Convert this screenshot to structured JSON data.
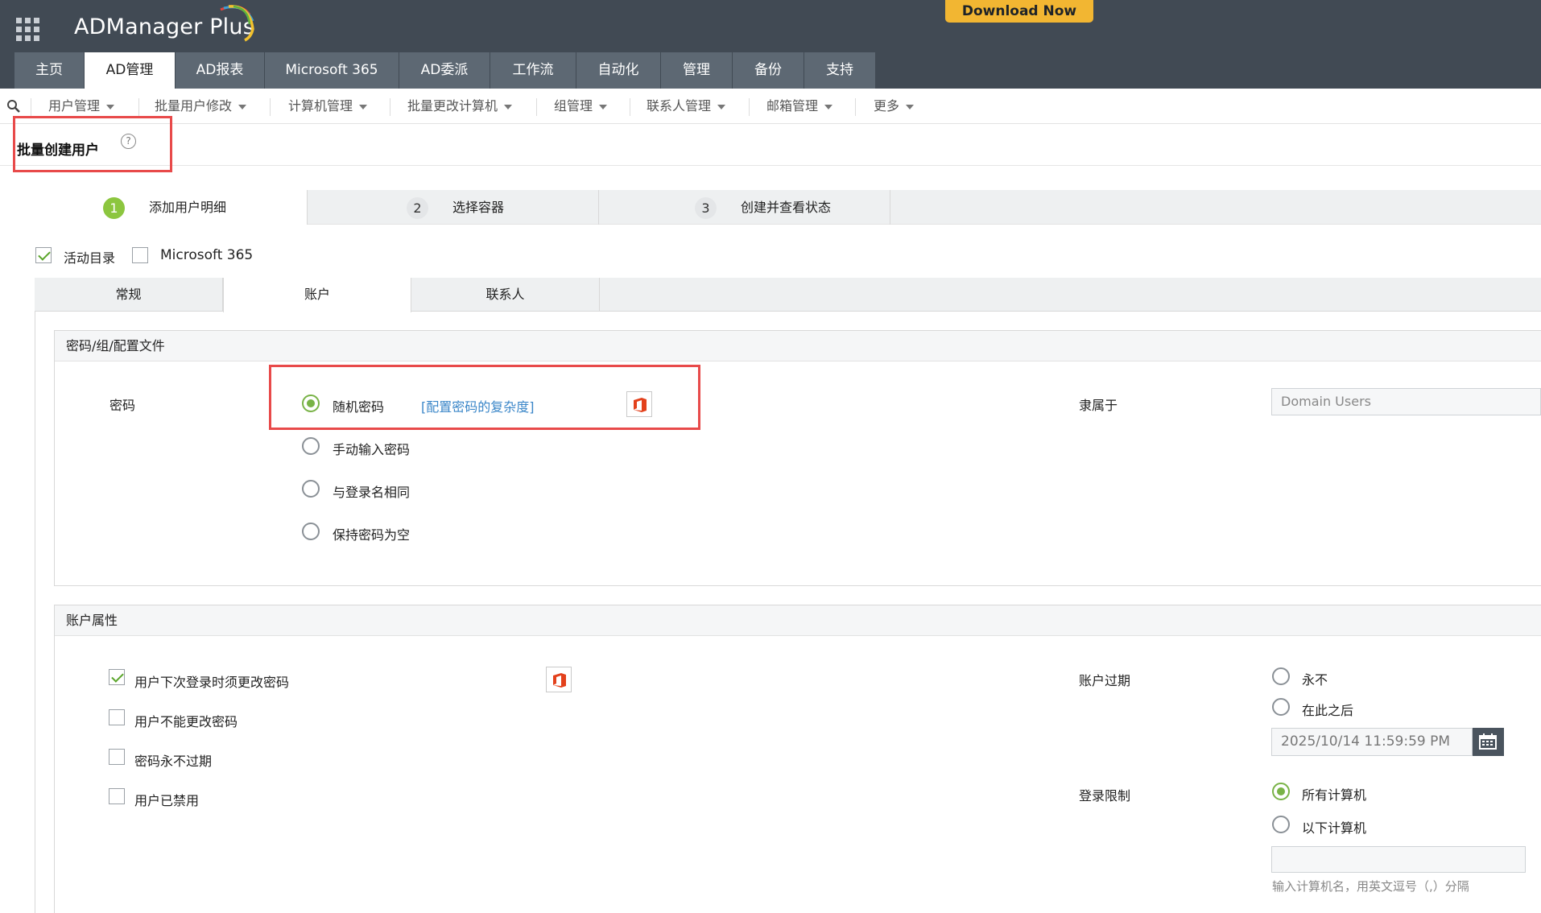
{
  "header": {
    "app_name": "ADManager Plus",
    "download_label": "Download Now",
    "nav_tabs": [
      {
        "label": "主页"
      },
      {
        "label": "AD管理"
      },
      {
        "label": "AD报表"
      },
      {
        "label": "Microsoft 365"
      },
      {
        "label": "AD委派"
      },
      {
        "label": "工作流"
      },
      {
        "label": "自动化"
      },
      {
        "label": "管理"
      },
      {
        "label": "备份"
      },
      {
        "label": "支持"
      }
    ],
    "active_tab": "AD管理"
  },
  "submenu": {
    "items": [
      {
        "label": "用户管理"
      },
      {
        "label": "批量用户修改"
      },
      {
        "label": "计算机管理"
      },
      {
        "label": "批量更改计算机"
      },
      {
        "label": "组管理"
      },
      {
        "label": "联系人管理"
      },
      {
        "label": "邮箱管理"
      },
      {
        "label": "更多"
      }
    ]
  },
  "page": {
    "title": "批量创建用户",
    "help_glyph": "?"
  },
  "wizard": {
    "steps": [
      {
        "num": "1",
        "label": "添加用户明细"
      },
      {
        "num": "2",
        "label": "选择容器"
      },
      {
        "num": "3",
        "label": "创建并查看状态"
      }
    ],
    "active_step": 1
  },
  "targets": {
    "active_directory": {
      "label": "活动目录",
      "checked": true
    },
    "microsoft365": {
      "label": "Microsoft 365",
      "checked": false
    }
  },
  "inner_tabs": [
    {
      "label": "常规"
    },
    {
      "label": "账户"
    },
    {
      "label": "联系人"
    }
  ],
  "active_inner_tab": "账户",
  "password_section": {
    "title": "密码/组/配置文件",
    "password_label": "密码",
    "options": [
      {
        "label": "随机密码",
        "selected": true
      },
      {
        "label": "手动输入密码",
        "selected": false
      },
      {
        "label": "与登录名相同",
        "selected": false
      },
      {
        "label": "保持密码为空",
        "selected": false
      }
    ],
    "complexity_link": "[配置密码的复杂度]",
    "member_of_label": "隶属于",
    "member_of_value": "Domain Users"
  },
  "account_section": {
    "title": "账户属性",
    "checkboxes": [
      {
        "label": "用户下次登录时须更改密码",
        "checked": true
      },
      {
        "label": "用户不能更改密码",
        "checked": false
      },
      {
        "label": "密码永不过期",
        "checked": false
      },
      {
        "label": "用户已禁用",
        "checked": false
      }
    ],
    "expiry_label": "账户过期",
    "expiry_options": [
      {
        "label": "永不",
        "selected": false
      },
      {
        "label": "在此之后",
        "selected": false
      }
    ],
    "expiry_date": "2025/10/14 11:59:59 PM",
    "logon_label": "登录限制",
    "logon_options": [
      {
        "label": "所有计算机",
        "selected": true
      },
      {
        "label": "以下计算机",
        "selected": false
      }
    ],
    "computers_hint": "输入计算机名，用英文逗号（,）分隔"
  },
  "colors": {
    "header_bg": "#414a54",
    "tab_bg": "#5d6873",
    "accent_green": "#8cc63f",
    "download_bg": "#f2b632",
    "highlight_red": "#e84a4a",
    "link_blue": "#3a86c8"
  }
}
